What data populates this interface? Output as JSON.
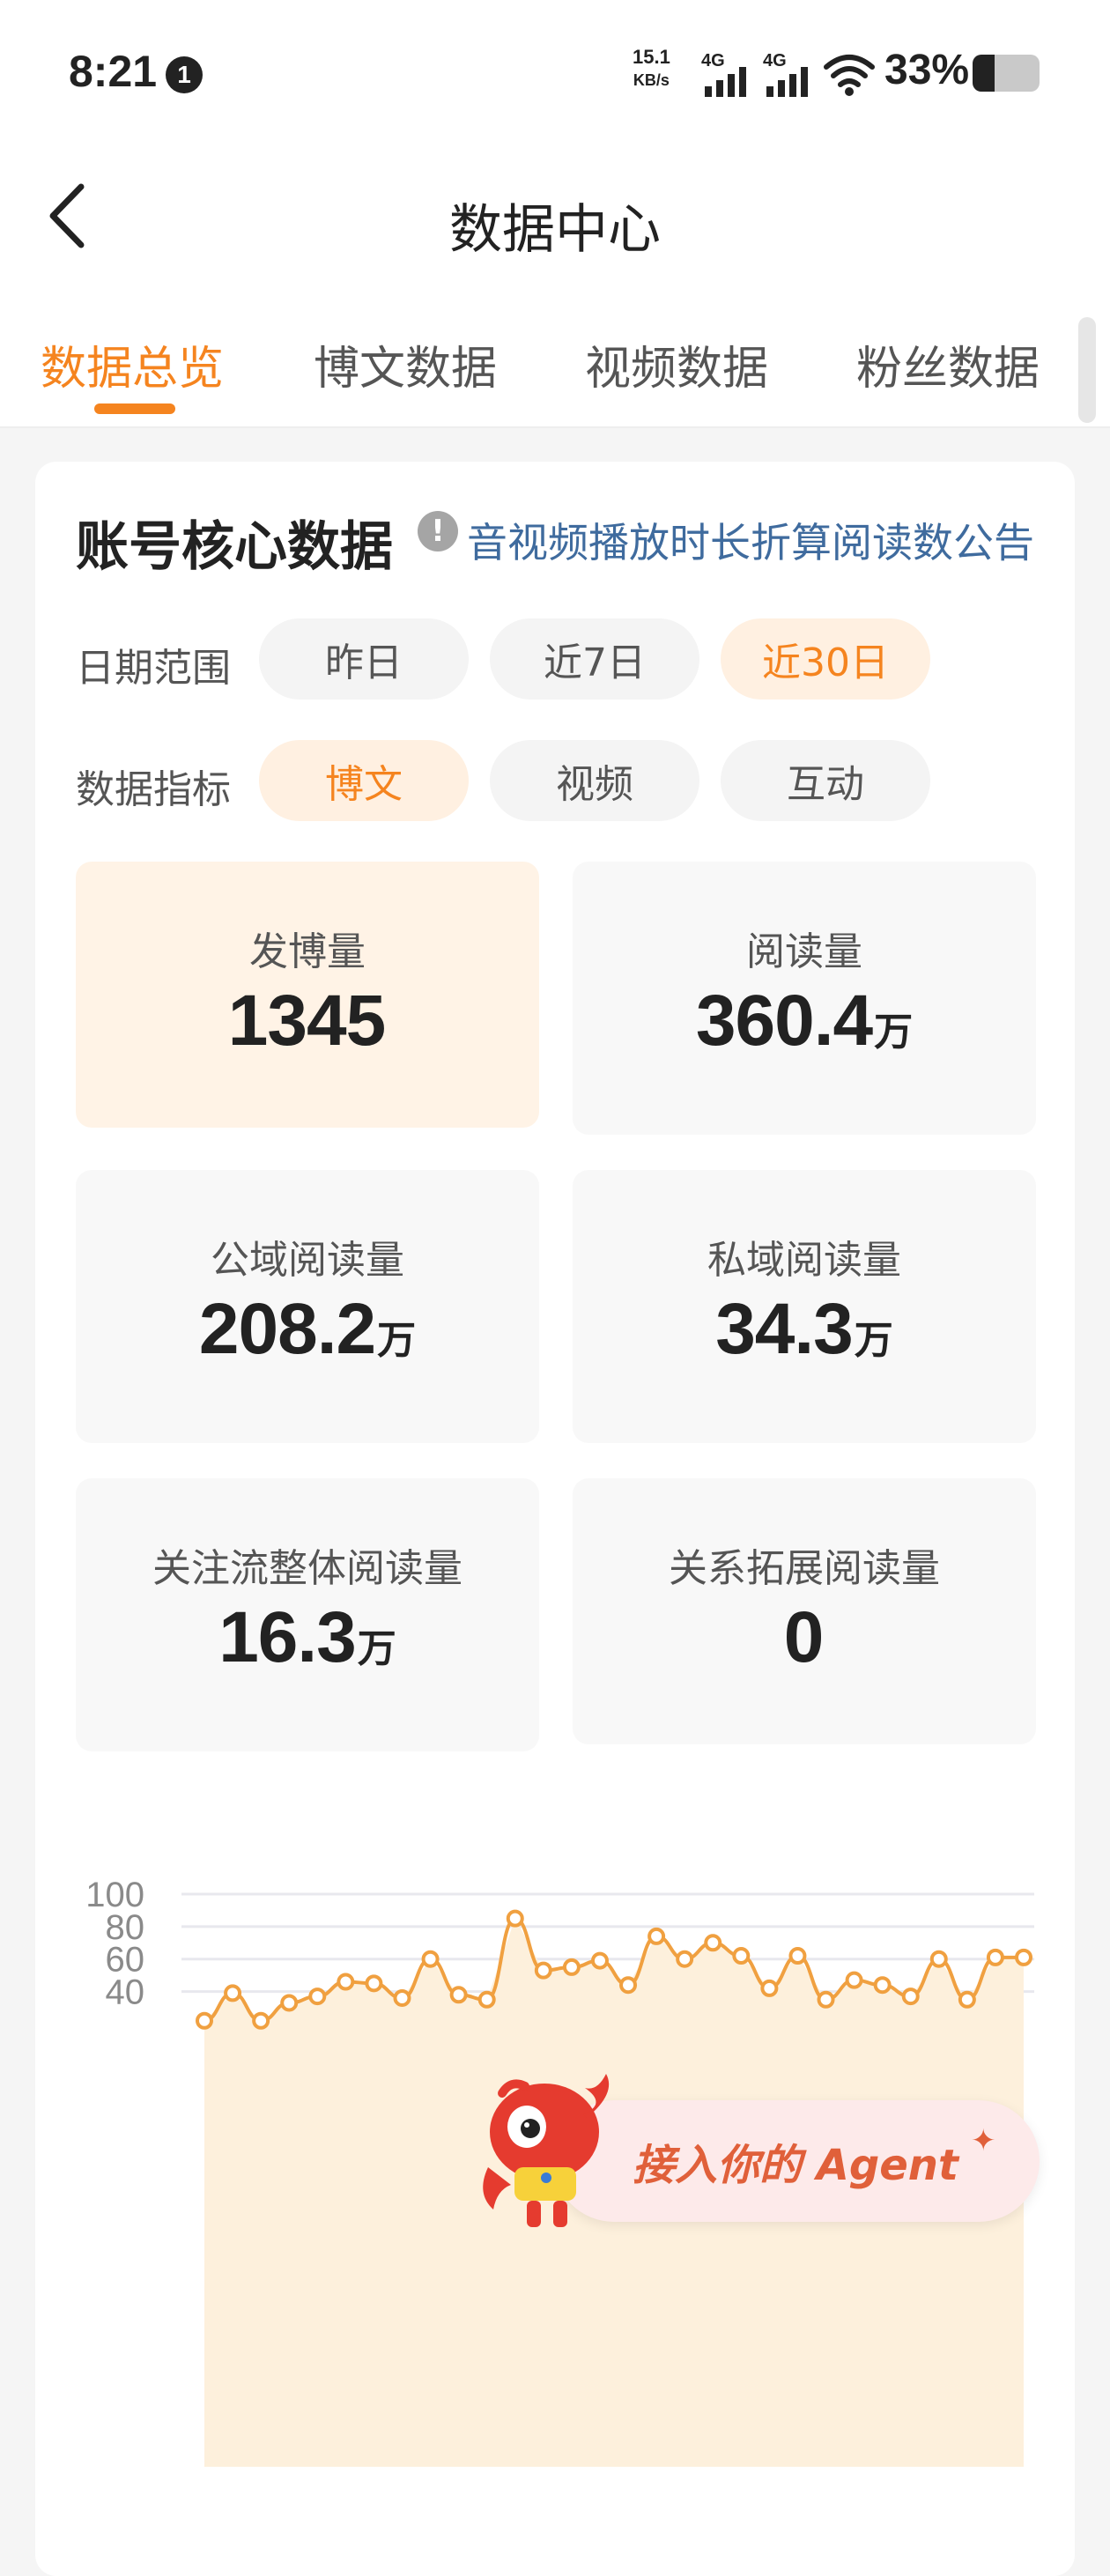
{
  "status_bar": {
    "time": "8:21",
    "notification_count": "1",
    "net_speed_value": "15.1",
    "net_speed_unit": "KB/s",
    "signal_1_label": "4G",
    "signal_2_label": "4G",
    "battery_text": "33%",
    "battery_level": 0.33
  },
  "navbar": {
    "title": "数据中心"
  },
  "tabs": [
    {
      "label": "数据总览",
      "active": true
    },
    {
      "label": "博文数据",
      "active": false
    },
    {
      "label": "视频数据",
      "active": false
    },
    {
      "label": "粉丝数据",
      "active": false
    }
  ],
  "core_data": {
    "title": "账号核心数据",
    "info_icon": "!",
    "notice_link": "音视频播放时长折算阅读数公告",
    "date_range_label": "日期范围",
    "date_options": [
      "昨日",
      "近7日",
      "近30日"
    ],
    "date_selected": "近30日",
    "metric_label": "数据指标",
    "metric_options": [
      "博文",
      "视频",
      "互动"
    ],
    "metric_selected": "博文",
    "metrics": [
      {
        "label": "发博量",
        "value": "1345",
        "unit": "",
        "selected": true
      },
      {
        "label": "阅读量",
        "value": "360.4",
        "unit": "万",
        "selected": false
      },
      {
        "label": "公域阅读量",
        "value": "208.2",
        "unit": "万",
        "selected": false
      },
      {
        "label": "私域阅读量",
        "value": "34.3",
        "unit": "万",
        "selected": false
      },
      {
        "label": "关注流整体阅读量",
        "value": "16.3",
        "unit": "万",
        "selected": false
      },
      {
        "label": "关系拓展阅读量",
        "value": "0",
        "unit": "",
        "selected": false
      }
    ]
  },
  "chart_data": {
    "type": "area",
    "title": "",
    "xlabel": "",
    "ylabel": "",
    "y_ticks": [
      "100",
      "80",
      "60",
      "40"
    ],
    "ylim": [
      0,
      100
    ],
    "grid": true,
    "colors": {
      "line": "#f0a040",
      "fill": "#fdf0dc",
      "point_fill": "#ffffff",
      "grid": "#e8e8ee"
    },
    "x": [
      1,
      2,
      3,
      4,
      5,
      6,
      7,
      8,
      9,
      10,
      11,
      12,
      13,
      14,
      15,
      16,
      17,
      18,
      19,
      20,
      21,
      22,
      23,
      24,
      25,
      26,
      27,
      28,
      29,
      30
    ],
    "values": [
      22,
      39,
      22,
      33,
      37,
      46,
      45,
      36,
      60,
      38,
      35,
      85,
      53,
      55,
      59,
      44,
      74,
      60,
      70,
      62,
      42,
      62,
      35,
      47,
      44,
      37,
      60,
      35,
      61,
      61
    ]
  },
  "agent_button": {
    "text": "接入你的 Agent",
    "sparkle_icon": "✦",
    "mascot_icon": "crab-mascot-icon"
  }
}
